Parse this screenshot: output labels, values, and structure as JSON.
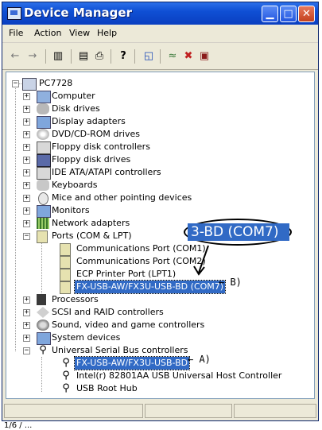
{
  "window": {
    "title": "Device Manager"
  },
  "menu": [
    "File",
    "Action",
    "View",
    "Help"
  ],
  "toolbar": [
    {
      "icon": "back-arrow-icon",
      "glyph": "←"
    },
    {
      "icon": "forward-arrow-icon",
      "glyph": "→"
    },
    {
      "icon": "console-tree-icon",
      "glyph": "▥"
    },
    {
      "icon": "properties-icon",
      "glyph": "▤"
    },
    {
      "icon": "print-icon",
      "glyph": "⎙"
    },
    {
      "icon": "help-icon",
      "glyph": "?"
    },
    {
      "icon": "scan-hardware-icon",
      "glyph": "◱"
    },
    {
      "icon": "update-driver-icon",
      "glyph": "≈"
    },
    {
      "icon": "uninstall-icon",
      "glyph": "✖"
    },
    {
      "icon": "disable-icon",
      "glyph": "▣"
    }
  ],
  "tree": {
    "root": "PC7728",
    "items": [
      "Computer",
      "Disk drives",
      "Display adapters",
      "DVD/CD-ROM drives",
      "Floppy disk controllers",
      "Floppy disk drives",
      "IDE ATA/ATAPI controllers",
      "Keyboards",
      "Mice and other pointing devices",
      "Monitors",
      "Network adapters",
      "Ports (COM & LPT)",
      "Communications Port (COM1)",
      "Communications Port (COM2)",
      "ECP Printer Port (LPT1)",
      "FX-USB-AW/FX3U-USB-BD (COM7)",
      "Processors",
      "SCSI and RAID controllers",
      "Sound, video and game controllers",
      "System devices",
      "Universal Serial Bus controllers",
      "FX-USB-AW/FX3U-USB-BD",
      "Intel(r) 82801AA USB Universal Host Controller",
      "USB Root Hub"
    ]
  },
  "callout": {
    "text": "3-BD (COM7)"
  },
  "annotations": {
    "b": "← B)",
    "a": "← A)"
  },
  "footer_text": "1/6 / ..."
}
